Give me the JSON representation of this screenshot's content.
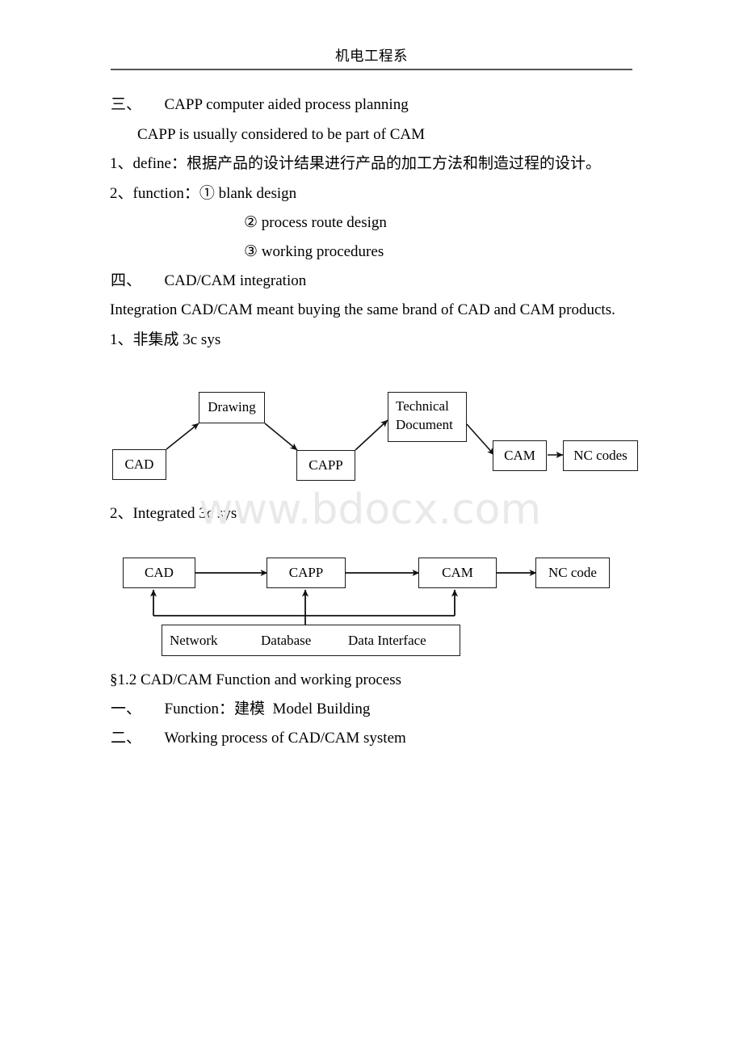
{
  "header": {
    "title": "机电工程系"
  },
  "body_lines": [
    {
      "id": "l1",
      "text": "三、  CAPP computer aided process planning"
    },
    {
      "id": "l2",
      "text": "CAPP is usually considered to be part of CAM"
    },
    {
      "id": "l3",
      "text": "1、define：根据产品的设计结果进行产品的加工方法和制造过程的设计。"
    },
    {
      "id": "l4",
      "text": "2、function：① blank design"
    },
    {
      "id": "l5",
      "text": "② process route design"
    },
    {
      "id": "l6",
      "text": "③ working procedures"
    },
    {
      "id": "l7",
      "text": "四、  CAD/CAM integration"
    },
    {
      "id": "l8",
      "text": "Integration CAD/CAM meant buying the same brand of CAD and CAM products."
    },
    {
      "id": "l9",
      "text": "1、非集成 3c sys"
    },
    {
      "id": "l10",
      "text": "2、Integrated 3c sys"
    },
    {
      "id": "l11",
      "text": "§1.2 CAD/CAM Function and working process"
    },
    {
      "id": "l12",
      "text": "一、  Function：建模  Model Building"
    },
    {
      "id": "l13",
      "text": "二、  Working process of CAD/CAM system"
    }
  ],
  "watermark": {
    "text": "www.bdocx.com",
    "color": "#e9e9e9"
  },
  "diagram_nonintegrated": {
    "caption_ref": "1、非集成 3c sys",
    "nodes": [
      {
        "id": "n1",
        "label": "CAD"
      },
      {
        "id": "n2",
        "label": "Drawing"
      },
      {
        "id": "n3",
        "label": "CAPP"
      },
      {
        "id": "n4",
        "label_line1": "Technical",
        "label_line2": "Document"
      },
      {
        "id": "n5",
        "label": "CAM"
      },
      {
        "id": "n6",
        "label": "NC codes"
      }
    ],
    "flow": [
      "CAD",
      "Drawing",
      "CAPP",
      "Technical Document",
      "CAM",
      "NC codes"
    ]
  },
  "diagram_integrated": {
    "caption_ref": "2、Integrated 3c sys",
    "nodes": [
      {
        "id": "m1",
        "label": "CAD"
      },
      {
        "id": "m2",
        "label": "CAPP"
      },
      {
        "id": "m3",
        "label": "CAM"
      },
      {
        "id": "m4",
        "label": "NC code"
      }
    ],
    "flow": [
      "CAD",
      "CAPP",
      "CAM",
      "NC code"
    ],
    "support_bar": {
      "items": [
        "Network",
        "Database",
        "Data Interface"
      ],
      "feeds": [
        "CAD",
        "CAPP",
        "CAM"
      ]
    }
  }
}
